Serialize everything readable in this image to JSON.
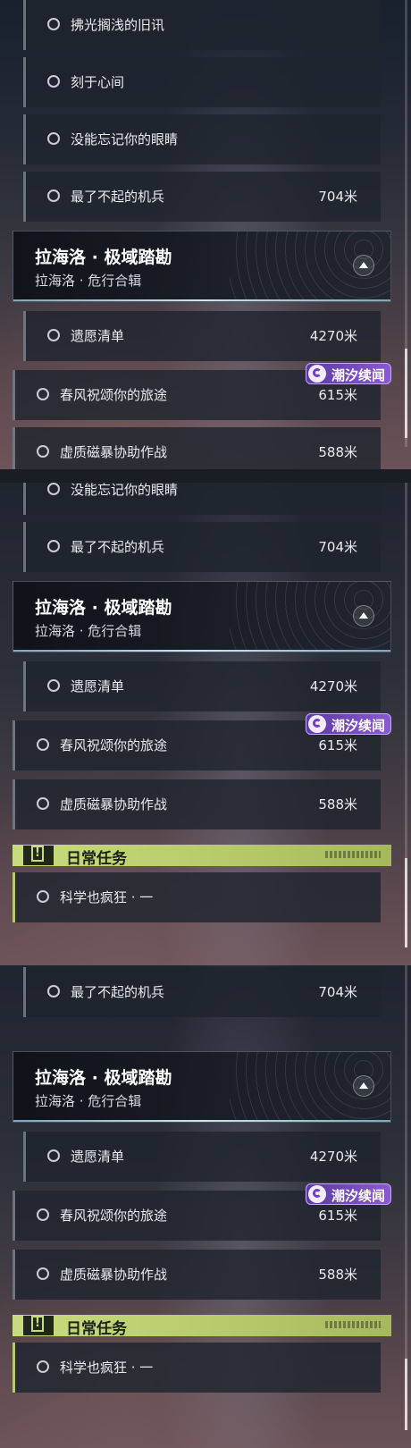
{
  "panel1": {
    "rows_top": [
      {
        "label": "拂光搁浅的旧讯",
        "distance": ""
      },
      {
        "label": "刻于心间",
        "distance": ""
      },
      {
        "label": "没能忘记你的眼睛",
        "distance": ""
      },
      {
        "label": "最了不起的机兵",
        "distance": "704米"
      }
    ],
    "section": {
      "title": "拉海洛 · 极域踏勘",
      "subtitle": "拉海洛 · 危行合辑"
    },
    "rows_section": [
      {
        "label": "遗愿清单",
        "distance": "4270米"
      }
    ],
    "badge": "潮汐续闻",
    "rows_outer": [
      {
        "label": "春风祝颂你的旅途",
        "distance": "615米"
      },
      {
        "label": "虚质磁暴协助作战",
        "distance": "588米"
      }
    ]
  },
  "panel2": {
    "rows_top": [
      {
        "label": "没能忘记你的眼睛",
        "distance": ""
      },
      {
        "label": "最了不起的机兵",
        "distance": "704米"
      }
    ],
    "section": {
      "title": "拉海洛 · 极域踏勘",
      "subtitle": "拉海洛 · 危行合辑"
    },
    "rows_section": [
      {
        "label": "遗愿清单",
        "distance": "4270米"
      }
    ],
    "badge": "潮汐续闻",
    "rows_outer": [
      {
        "label": "春风祝颂你的旅途",
        "distance": "615米"
      },
      {
        "label": "虚质磁暴协助作战",
        "distance": "588米"
      }
    ],
    "daily": {
      "title": "日常任务"
    },
    "rows_daily": [
      {
        "label": "科学也疯狂 · 一",
        "distance": ""
      }
    ]
  },
  "panel3": {
    "rows_top": [
      {
        "label": "最了不起的机兵",
        "distance": "704米"
      }
    ],
    "section": {
      "title": "拉海洛 · 极域踏勘",
      "subtitle": "拉海洛 · 危行合辑"
    },
    "rows_section": [
      {
        "label": "遗愿清单",
        "distance": "4270米"
      }
    ],
    "badge": "潮汐续闻",
    "rows_outer": [
      {
        "label": "春风祝颂你的旅途",
        "distance": "615米"
      },
      {
        "label": "虚质磁暴协助作战",
        "distance": "588米"
      }
    ],
    "daily": {
      "title": "日常任务"
    },
    "rows_daily": [
      {
        "label": "科学也疯狂 · 一",
        "distance": ""
      }
    ]
  },
  "icons": {
    "quest_marker": "circle-icon",
    "collapse": "chevron-up-icon",
    "badge": "tide-icon",
    "daily": "exclamation-icon"
  },
  "colors": {
    "daily_accent": "#b7c96a",
    "badge_purple": "#7a4cc4",
    "section_line": "#cfe4ee"
  }
}
